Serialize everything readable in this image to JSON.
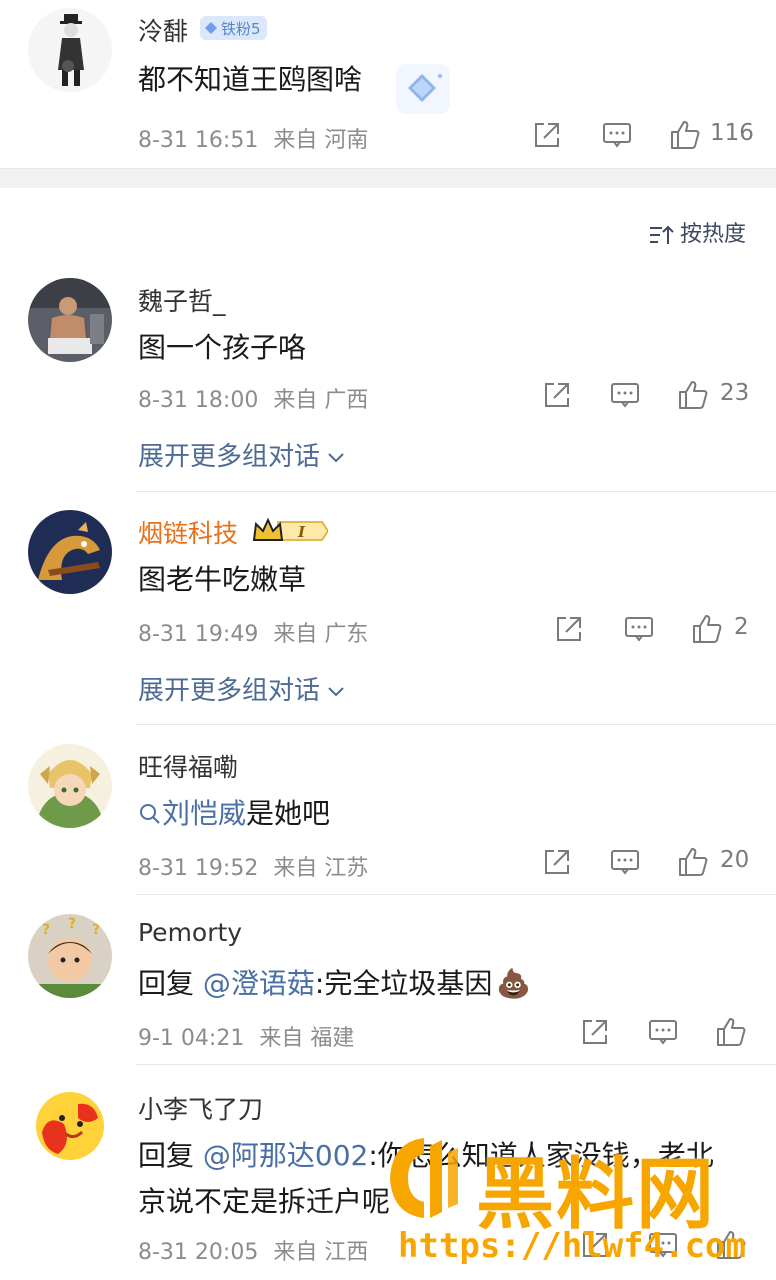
{
  "top_comment": {
    "username": "泠馡",
    "fan_badge": "铁粉5",
    "content": "都不知道王鸥图啥",
    "time": "8-31 16:51",
    "location": "来自 河南",
    "likes": "116"
  },
  "sort": {
    "label": "按热度"
  },
  "comments": [
    {
      "username": "魏子哲_",
      "content": "图一个孩子咯",
      "time": "8-31 18:00",
      "location": "来自 广西",
      "likes": "23",
      "expand": "展开更多组对话"
    },
    {
      "username": "烟链科技",
      "username_color": "#e8701a",
      "badge_level": "I",
      "content": "图老牛吃嫩草",
      "time": "8-31 19:49",
      "location": "来自 广东",
      "likes": "2",
      "expand": "展开更多组对话"
    },
    {
      "username": "旺得福嘞",
      "search_link": "刘恺威",
      "content": "是她吧",
      "time": "8-31 19:52",
      "location": "来自 江苏",
      "likes": "20"
    },
    {
      "username": "Pemorty",
      "reply_prefix": "回复 ",
      "mention": "@澄语菇",
      "content": ":完全垃圾基因",
      "emoji": "💩",
      "time": "9-1 04:21",
      "location": "来自 福建",
      "likes": ""
    },
    {
      "username": "小李飞了刀",
      "reply_prefix": "回复 ",
      "mention": "@阿那达002",
      "content_line1": ":你怎么知道人家没钱，老北",
      "content_line2": "京说不定是拆迁户呢",
      "time": "8-31 20:05",
      "location": "来自 江西",
      "likes": ""
    }
  ],
  "watermark": {
    "text": "黑料网",
    "url": "https://hlwf4.com"
  },
  "colors": {
    "link": "#4a6fa5",
    "watermark": "#f7a600",
    "meta": "#8c8c8c"
  },
  "icons": [
    "share-icon",
    "comment-icon",
    "like-icon",
    "chevron-down-icon",
    "sort-icon",
    "search-icon",
    "diamond-icon",
    "crown-icon"
  ]
}
